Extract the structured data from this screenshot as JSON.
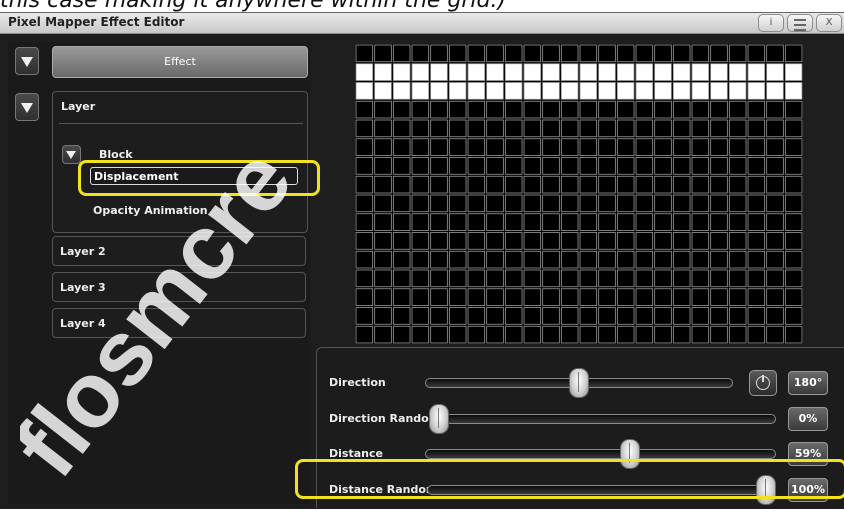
{
  "caption": "this case making it anywhere within the grid.)",
  "window": {
    "title": "Pixel Mapper Effect Editor",
    "info_label": "i",
    "close_label": "X"
  },
  "sidebar": {
    "effect_label": "Effect",
    "layer1_label": "Layer",
    "block_label": "Block",
    "displacement_label": "Displacement",
    "opacity_label": "Opacity Animation",
    "layer2_label": "Layer 2",
    "layer3_label": "Layer 3",
    "layer4_label": "Layer 4"
  },
  "grid": {
    "columns": 24,
    "rows": 16,
    "lit_rows": [
      1,
      2
    ],
    "lit_color": "#ffffff",
    "off_color": "#000000",
    "line_color": "#9a9a9a"
  },
  "controls": {
    "direction": {
      "label": "Direction",
      "value_text": "180°",
      "level": 0.5
    },
    "direction_random": {
      "label": "Direction Random",
      "value_text": "0%",
      "level": 0.0
    },
    "distance": {
      "label": "Distance",
      "value_text": "59%",
      "level": 0.59
    },
    "distance_random": {
      "label": "Distance Random",
      "value_text": "100%",
      "level": 1.0
    }
  },
  "colors": {
    "highlight": "#f2e21b",
    "background": "#1e1e1e",
    "watermark": "#ffffff"
  },
  "watermark_text": "flosmcre"
}
